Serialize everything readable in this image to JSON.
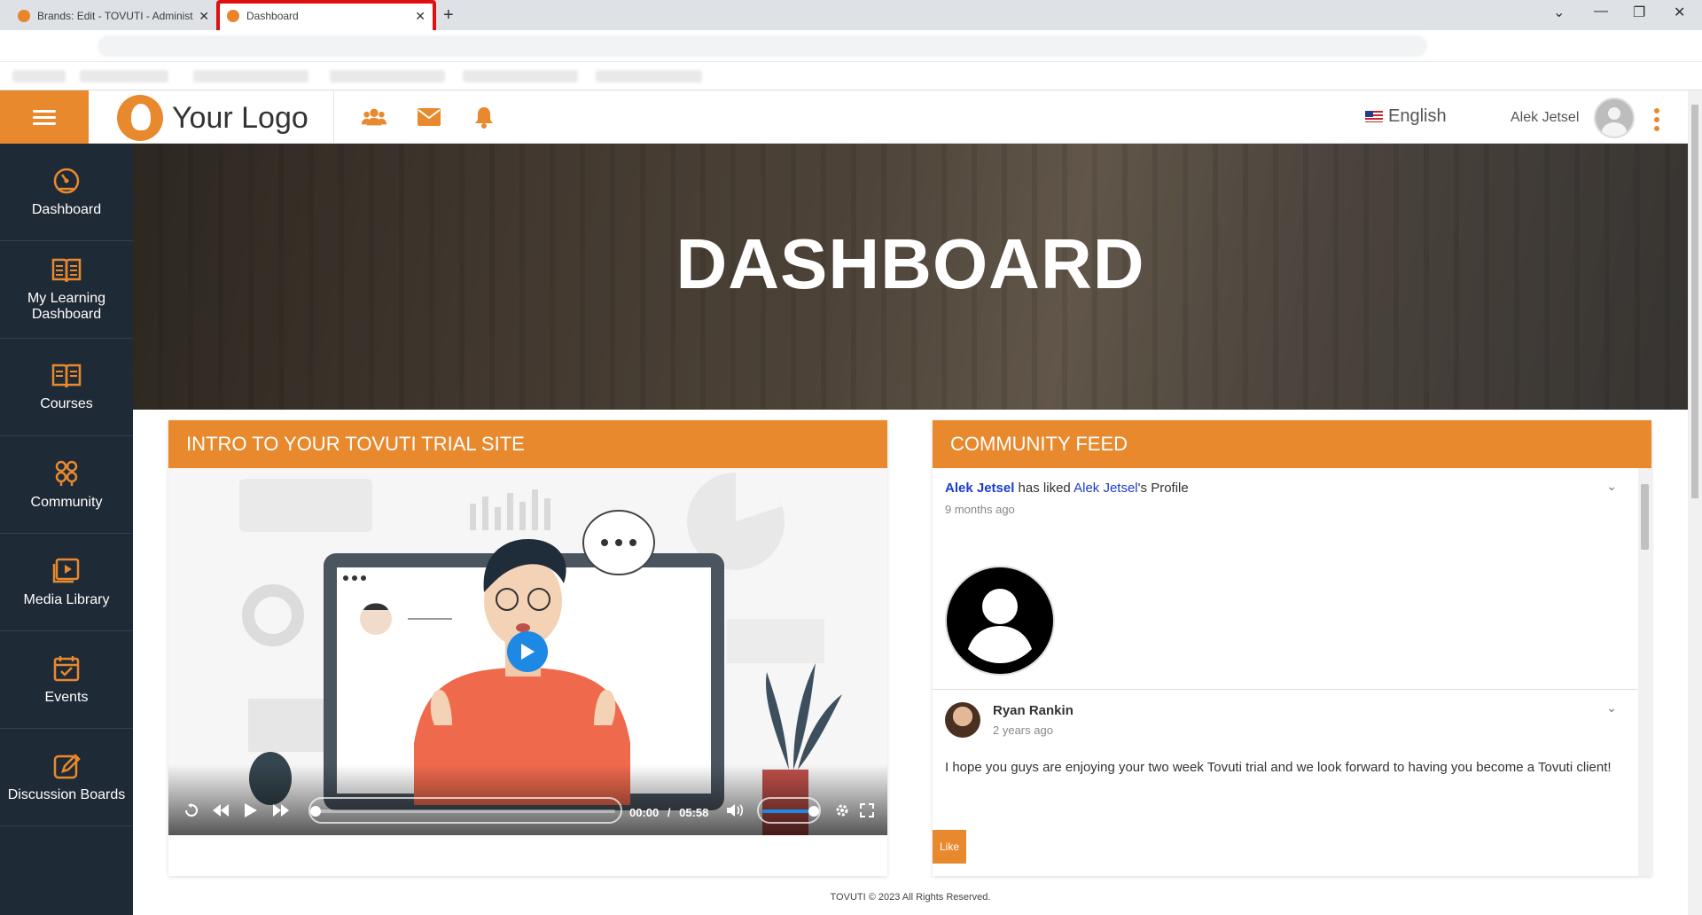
{
  "browser": {
    "tabs": [
      {
        "title": "Brands: Edit - TOVUTI - Administ",
        "close": "✕"
      },
      {
        "title": "Dashboard",
        "close": "✕"
      }
    ],
    "new_tab": "+",
    "window_controls": [
      "⌄",
      "—",
      "❐",
      "✕"
    ]
  },
  "header": {
    "logo_text": "Your Logo",
    "language": "English",
    "user_name": "Alek Jetsel",
    "icons": [
      "users-icon",
      "envelope-icon",
      "bell-icon"
    ]
  },
  "sidebar": {
    "items": [
      {
        "label": "Dashboard",
        "icon": "gauge-icon"
      },
      {
        "label": "My Learning Dashboard",
        "icon": "book-open-icon"
      },
      {
        "label": "Courses",
        "icon": "book-icon"
      },
      {
        "label": "Community",
        "icon": "community-icon"
      },
      {
        "label": "Media Library",
        "icon": "media-icon"
      },
      {
        "label": "Events",
        "icon": "calendar-icon"
      },
      {
        "label": "Discussion Boards",
        "icon": "edit-icon"
      }
    ]
  },
  "hero": {
    "title": "DASHBOARD"
  },
  "intro_card": {
    "title": "INTRO TO YOUR TOVUTI TRIAL SITE",
    "video": {
      "current": "00:00",
      "separator": "/",
      "duration": "05:58",
      "volume_level": 1.0
    }
  },
  "feed_card": {
    "title": "COMMUNITY FEED",
    "posts": [
      {
        "actor": "Alek Jetsel",
        "action": " has liked ",
        "target": "Alek Jetsel",
        "suffix": "'s Profile",
        "time": "9 months ago"
      },
      {
        "author": "Ryan Rankin",
        "time": "2 years ago",
        "body": "I hope you guys are enjoying your two week Tovuti trial and we look forward to having you become a Tovuti client!",
        "like_label": "Like"
      }
    ]
  },
  "footer": {
    "text": "TOVUTI © 2023 All Rights Reserved."
  },
  "colors": {
    "accent": "#e8892e",
    "sidebar": "#1f2a37",
    "link": "#1a3ccc"
  }
}
